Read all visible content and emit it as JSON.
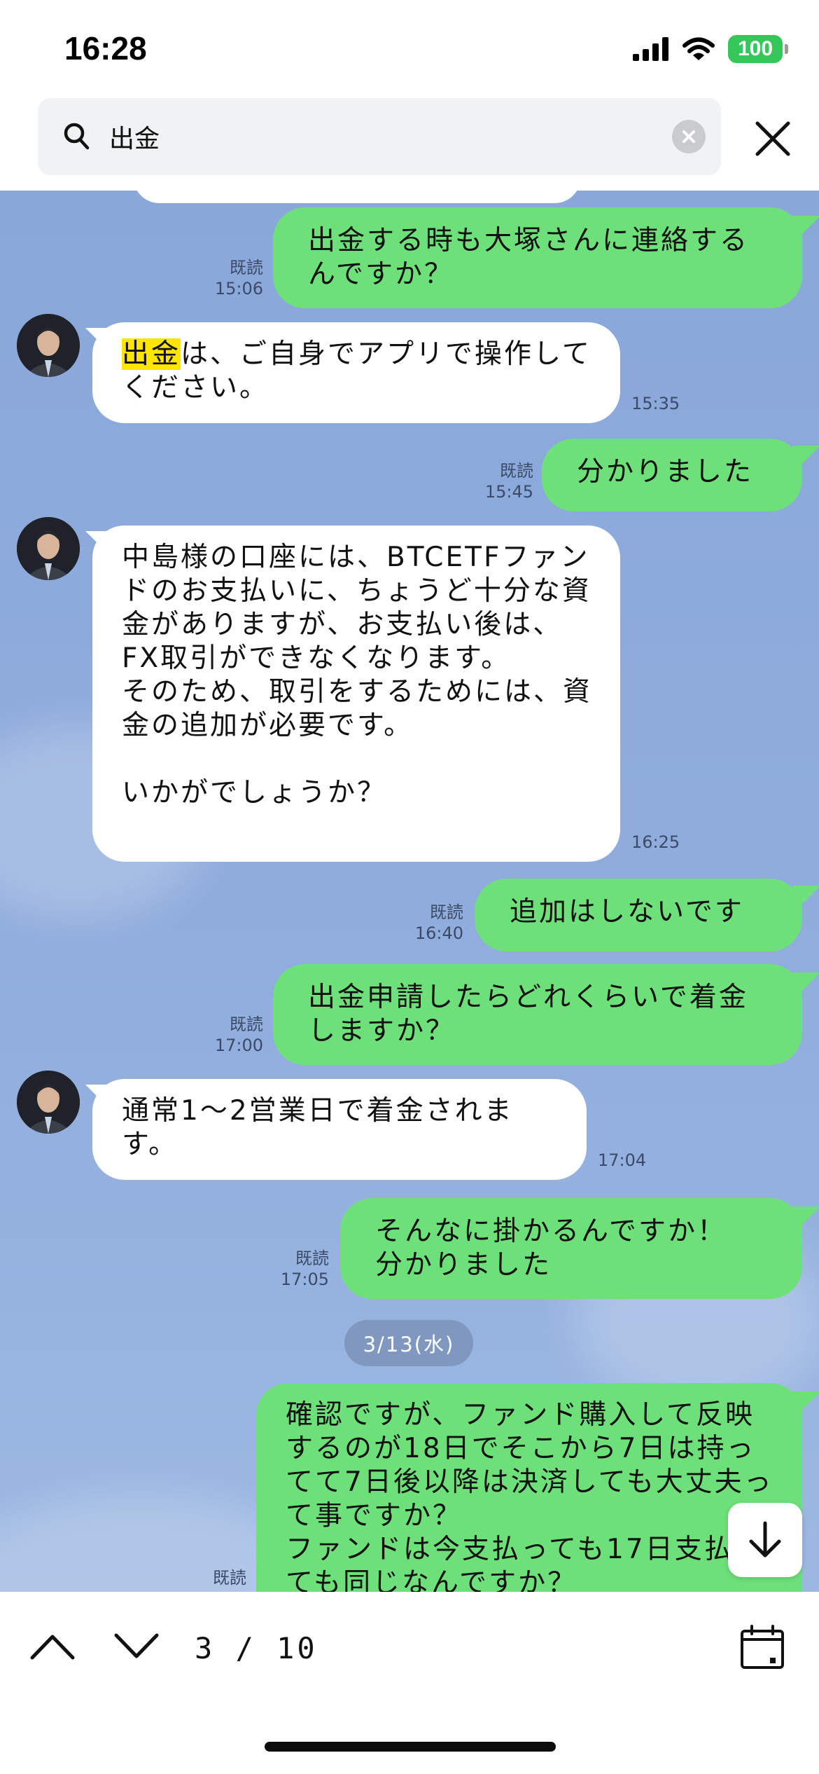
{
  "status_bar": {
    "time": "16:28",
    "battery": "100"
  },
  "search": {
    "query": "出金",
    "placeholder": ""
  },
  "messages": [
    {
      "side": "right",
      "text": "出金する時も大塚さんに連絡するんですか？",
      "read": "既読",
      "time": "15:06"
    },
    {
      "side": "left",
      "highlight": "出金",
      "text": "は、ご自身でアプリで操作してください。",
      "time": "15:35"
    },
    {
      "side": "right",
      "text": "分かりました",
      "read": "既読",
      "time": "15:45"
    },
    {
      "side": "left",
      "text": "中島様の口座には、BTCETFファンドのお支払いに、ちょうど十分な資金がありますが、お支払い後は、FX取引ができなくなります。\nそのため、取引をするためには、資金の追加が必要です。\n\nいかがでしょうか？",
      "time": "16:25"
    },
    {
      "side": "right",
      "text": "追加はしないです",
      "read": "既読",
      "time": "16:40"
    },
    {
      "side": "right",
      "text": "出金申請したらどれくらいで着金しますか？",
      "read": "既読",
      "time": "17:00"
    },
    {
      "side": "left",
      "text": "通常1～2営業日で着金されます。",
      "time": "17:04"
    },
    {
      "side": "right",
      "text": "そんなに掛かるんですか！\n分かりました",
      "read": "既読",
      "time": "17:05"
    },
    {
      "side": "right",
      "text": "確認ですが、ファンド購入して反映するのが18日でそこから7日は持ってて7日後以降は決済しても大丈夫って事ですか？\nファンドは今支払っても17日支払っても同じなんですか？",
      "read": "既読",
      "time": ""
    }
  ],
  "date_separator": "3/13(水)",
  "bottom_bar": {
    "page_count": "3 / 10"
  },
  "colors": {
    "chat_background": "#8aa7da",
    "sent_bubble": "#6ee07a",
    "received_bubble": "#ffffff",
    "highlight": "#ffe500",
    "battery": "#34c759"
  },
  "icons": [
    "search-icon",
    "clear-icon",
    "close-icon",
    "chevron-up-icon",
    "chevron-down-icon",
    "calendar-icon",
    "arrow-down-icon",
    "wifi-icon",
    "signal-icon"
  ]
}
